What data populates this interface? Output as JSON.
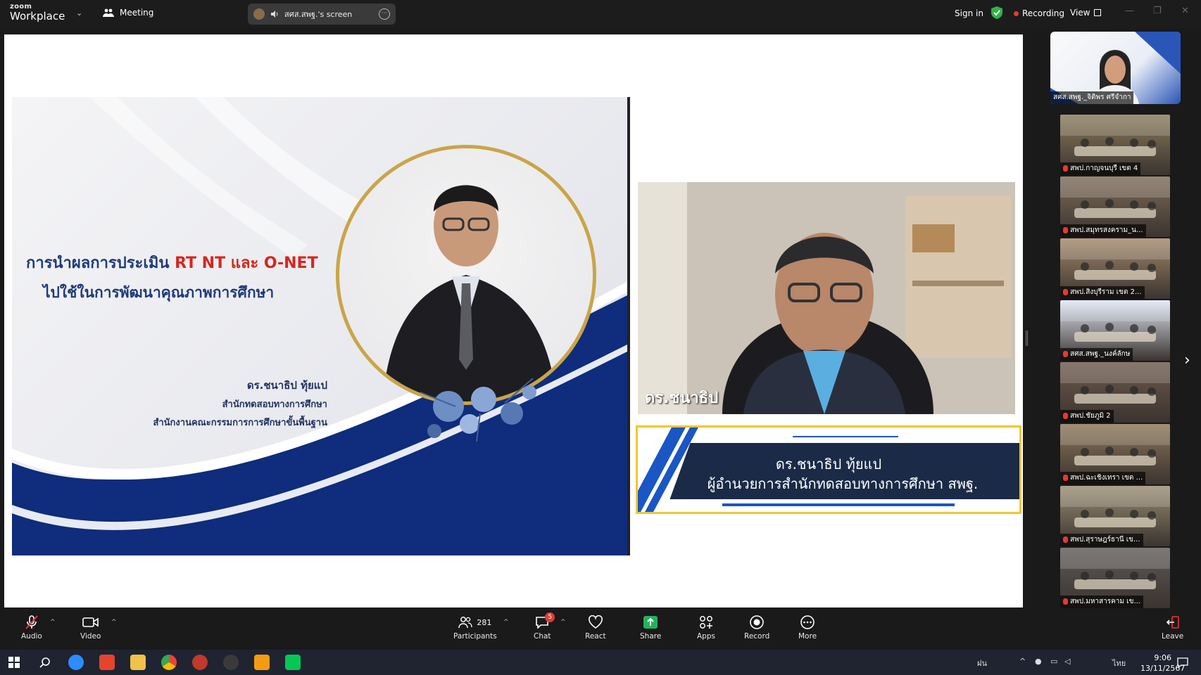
{
  "app": {
    "brand_top": "zoom",
    "brand_name": "Workplace",
    "meeting_label": "Meeting",
    "screen_share_label": "สศส.สพฐ.'s screen",
    "sign_in": "Sign in",
    "recording_label": "Recording",
    "view_label": "View"
  },
  "slide": {
    "title_part1": "การนำผลการประเมิน ",
    "title_highlight": "RT NT และ O-NET",
    "title_line2": "ไปใช้ในการพัฒนาคุณภาพการศึกษา",
    "presenter_name": "ดร.ชนาธิป ทุ้ยแป",
    "org_line1": "สำนักทดสอบทางการศึกษา",
    "org_line2": "สำนักงานคณะกรรมการการศึกษาขั้นพื้นฐาน"
  },
  "speaker": {
    "name_overlay": "ดร.ชนาธิป",
    "lower_third_name": "ดร.ชนาธิป ทุ้ยแป",
    "lower_third_role": "ผู้อำนวยการสำนักทดสอบทางการศึกษา สพฐ."
  },
  "self_view": {
    "label": "สศส.สพฐ._จิติพร ศรีจำกา"
  },
  "participants_tiles": [
    {
      "label": "สพป.กาญจนบุรี เขต 4",
      "color": "#8a7a5a"
    },
    {
      "label": "สพป.สมุทรสงคราม_น...",
      "color": "#7d6b58"
    },
    {
      "label": "สพป.สิงบุรีราม เขต 2...",
      "color": "#a2876a"
    },
    {
      "label": "สศส.สพฐ._นงค์ลักษ",
      "color": "#dfe6f3"
    },
    {
      "label": "สพป.ชัยภูมิ 2",
      "color": "#6e5a4c"
    },
    {
      "label": "สพป.ฉะเชิงเทรา เขต ...",
      "color": "#8b7558"
    },
    {
      "label": "สพป.สุราษฎร์ธานี เข...",
      "color": "#9a8d73"
    },
    {
      "label": "สพป.มหาสารคาม เข...",
      "color": "#5e5a58"
    }
  ],
  "toolbar": {
    "audio": "Audio",
    "video": "Video",
    "participants": "Participants",
    "participants_count": "281",
    "chat": "Chat",
    "chat_badge": "5",
    "react": "React",
    "share": "Share",
    "apps": "Apps",
    "record": "Record",
    "more": "More",
    "leave": "Leave"
  },
  "taskbar": {
    "lang": "ไทย",
    "weather": "ฝน",
    "time": "9:06",
    "date": "13/11/2567"
  },
  "colors": {
    "accent_red": "#e53935",
    "share_green": "#22b35e",
    "slide_navy": "#1f3a7a",
    "gold": "#c9a548"
  }
}
